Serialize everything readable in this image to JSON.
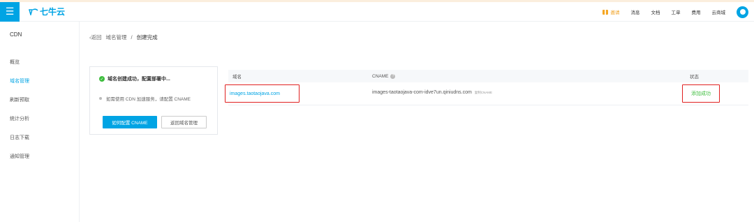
{
  "topbar": {
    "menu_icon": "hamburger-icon",
    "logo_text": "七牛云",
    "nav": {
      "promo": "邀请",
      "messages": "消息",
      "docs": "文档",
      "tickets": "工单",
      "billing": "费用",
      "market": "云商城"
    },
    "accent_color": "#00a4e4"
  },
  "sidebar": {
    "section": "CDN",
    "items": [
      {
        "label": "概览"
      },
      {
        "label": "域名管理"
      },
      {
        "label": "刷新预取"
      },
      {
        "label": "统计分析"
      },
      {
        "label": "日志下载"
      },
      {
        "label": "通知管理"
      }
    ]
  },
  "breadcrumb": {
    "back": "返回",
    "parent": "域名管理",
    "separator": "/",
    "current": "创建完成"
  },
  "card": {
    "status_text": "域名创建成功，配置部署中...",
    "hint_text": "如需使用 CDN 加速服务，请配置 CNAME",
    "primary_button": "如何配置 CNAME",
    "secondary_button": "返回域名管理"
  },
  "table": {
    "headers": {
      "domain": "域名",
      "cname": "CNAME",
      "status": "状态"
    },
    "rows": [
      {
        "domain": "images.taotaojava.com",
        "cname": "images-taotaojava-com-idve7un.qiniudns.com",
        "copy_label": "复制CNAME",
        "status": "添加成功"
      }
    ]
  }
}
